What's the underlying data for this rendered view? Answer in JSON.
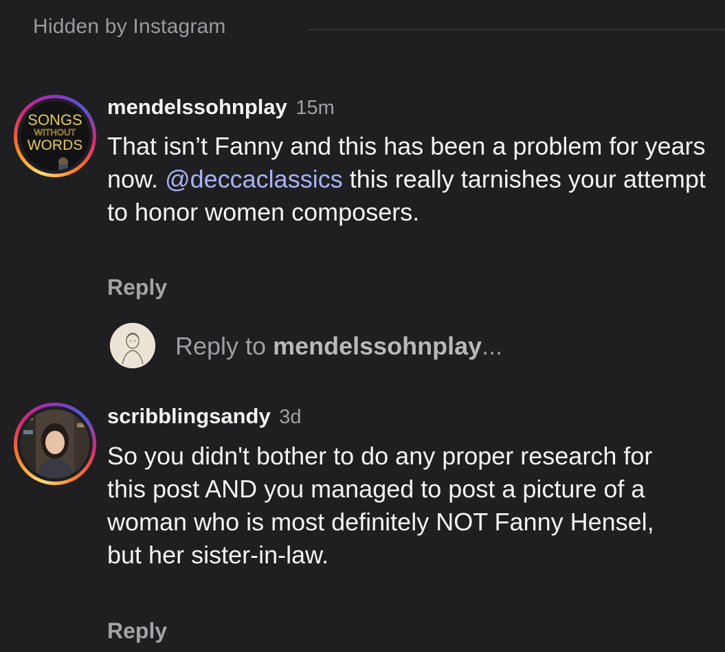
{
  "header": {
    "hidden_label": "Hidden by Instagram"
  },
  "comments": [
    {
      "username": "mendelssohnplay",
      "time": "15m",
      "text_before": "That isn’t Fanny and this has been a problem for years now. ",
      "mention": "@deccaclassics",
      "text_after": " this really tarnishes your attempt to honor women composers.",
      "reply_label": "Reply",
      "avatar": {
        "line1": "SONGS",
        "line2": "WITHOUT",
        "line3": "WORDS"
      }
    },
    {
      "username": "scribblingsandy",
      "time": "3d",
      "text": "So you didn't bother to do any proper research for this post AND you managed to post a picture of a woman who is most definitely NOT Fanny Hensel, but her sister-in-law.",
      "reply_label": "Reply"
    }
  ],
  "reply_composer": {
    "prefix": "Reply to ",
    "username": "mendelssohnplay",
    "suffix": "..."
  },
  "colors": {
    "background": "#1f1f22",
    "mention": "#a7b5f5",
    "muted": "#a3a3a8"
  }
}
